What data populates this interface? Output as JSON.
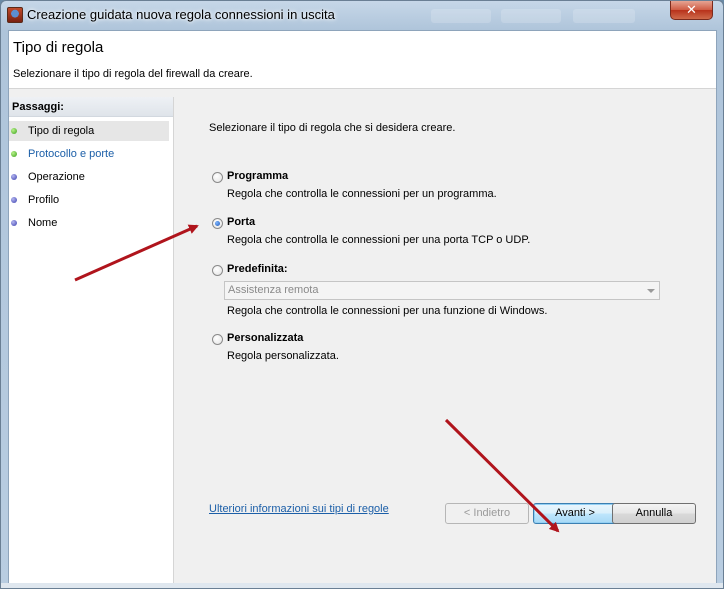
{
  "window": {
    "title": "Creazione guidata nuova regola connessioni in uscita",
    "close_glyph": "✕"
  },
  "header": {
    "title": "Tipo di regola",
    "subtitle": "Selezionare il tipo di regola del firewall da creare."
  },
  "sidebar": {
    "heading": "Passaggi:",
    "steps": [
      {
        "label": "Tipo di regola",
        "dot": "green",
        "state": "current"
      },
      {
        "label": "Protocollo e porte",
        "dot": "green",
        "state": "link"
      },
      {
        "label": "Operazione",
        "dot": "blue",
        "state": "normal"
      },
      {
        "label": "Profilo",
        "dot": "blue",
        "state": "normal"
      },
      {
        "label": "Nome",
        "dot": "blue",
        "state": "normal"
      }
    ]
  },
  "main": {
    "prompt": "Selezionare il tipo di regola che si desidera creare.",
    "options": [
      {
        "title": "Programma",
        "desc": "Regola che controlla le connessioni per un programma.",
        "checked": false
      },
      {
        "title": "Porta",
        "desc": "Regola che controlla le connessioni per una porta TCP o UDP.",
        "checked": true
      },
      {
        "title": "Predefinita:",
        "desc": "Regola che controlla le connessioni per una funzione di Windows.",
        "checked": false
      },
      {
        "title": "Personalizzata",
        "desc": "Regola personalizzata.",
        "checked": false
      }
    ],
    "predefined_select": {
      "value": "Assistenza remota",
      "enabled": false
    },
    "more_info_link": "Ulteriori informazioni sui tipi di regole"
  },
  "buttons": {
    "back": "< Indietro",
    "next": "Avanti >",
    "cancel": "Annulla"
  },
  "annotation_color": "#b0141c"
}
